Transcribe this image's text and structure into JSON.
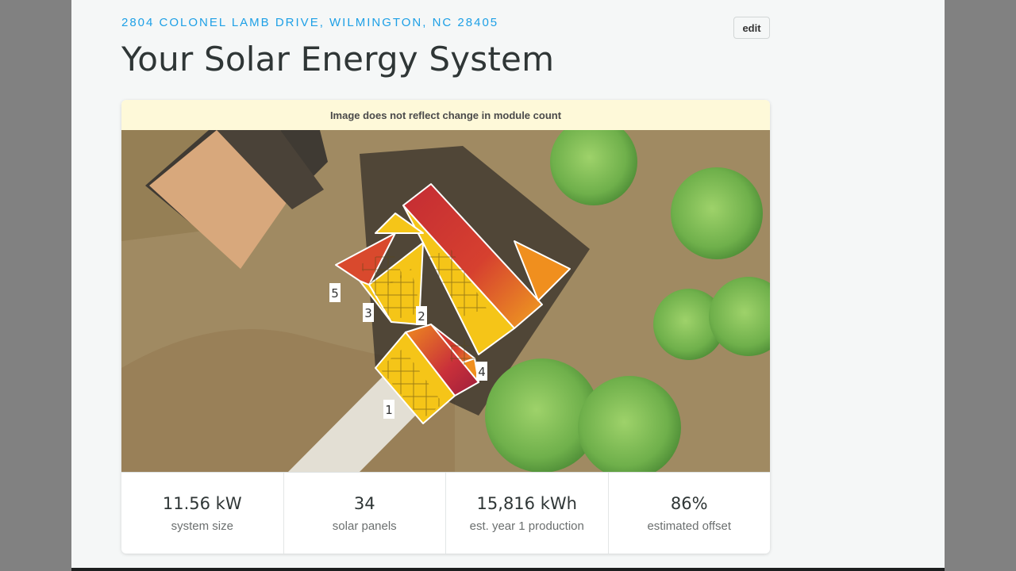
{
  "header": {
    "address": "2804 COLONEL LAMB DRIVE, WILMINGTON, NC 28405",
    "edit_label": "edit",
    "title": "Your Solar Energy System"
  },
  "map": {
    "notice": "Image does not reflect change in module count",
    "segments": [
      {
        "label": "1"
      },
      {
        "label": "2"
      },
      {
        "label": "3"
      },
      {
        "label": "4"
      },
      {
        "label": "5"
      }
    ]
  },
  "stats": [
    {
      "value": "11.56 kW",
      "label": "system size"
    },
    {
      "value": "34",
      "label": "solar panels"
    },
    {
      "value": "15,816 kWh",
      "label": "est. year 1 production"
    },
    {
      "value": "86%",
      "label": "estimated offset"
    }
  ],
  "colors": {
    "accent": "#1ea0e6",
    "irradiance_high": "#f5c518",
    "irradiance_mid": "#ef8a1f",
    "irradiance_low": "#c6283a"
  }
}
